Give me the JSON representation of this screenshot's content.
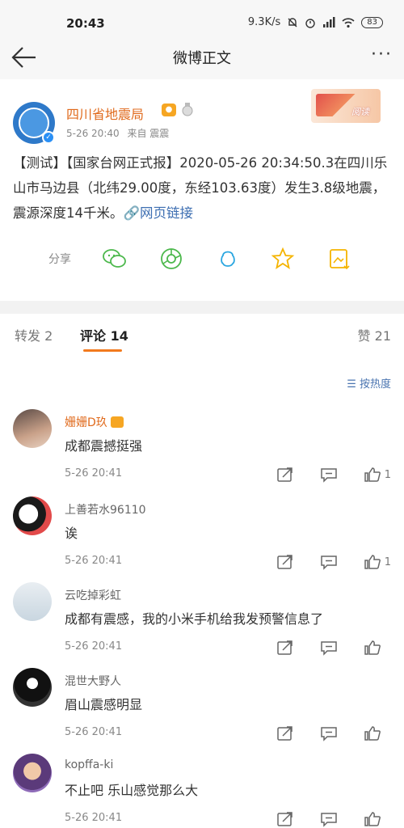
{
  "status": {
    "time": "20:43",
    "net_speed": "9.3K/s",
    "battery": "83"
  },
  "nav": {
    "title": "微博正文",
    "more": "···"
  },
  "post": {
    "author": "四川省地震局",
    "time": "5-26 20:40",
    "source": "来自 震震",
    "anniversary_stamp": "阅读",
    "body": "【测试】【国家台网正式报】2020-05-26 20:34:50.3在四川乐山市马边县（北纬29.00度，东经103.63度）发生3.8级地震，震源深度14千米。",
    "link_text": "网页链接",
    "share_label": "分享",
    "share_icons": [
      "wechat-icon",
      "moments-icon",
      "qq-icon",
      "qzone-star-icon",
      "save-image-icon"
    ]
  },
  "tabs": {
    "repost": "转发 2",
    "comments": "评论 14",
    "likes": "赞 21"
  },
  "sort_label": "按热度",
  "comments": [
    {
      "user": "姗姗D玖",
      "text": "成都震撼挺强",
      "time": "5-26 20:41",
      "likes": "1"
    },
    {
      "user": "上善若水96110",
      "text": "诶",
      "time": "5-26 20:41",
      "likes": "1"
    },
    {
      "user": "云吃掉彩虹",
      "text": "成都有震感，我的小米手机给我发预警信息了",
      "time": "5-26 20:41",
      "likes": ""
    },
    {
      "user": "混世大野人",
      "text": "眉山震感明显",
      "time": "5-26 20:41",
      "likes": ""
    },
    {
      "user": "kopffa-ki",
      "text": "不止吧 乐山感觉那么大",
      "time": "5-26 20:41",
      "likes": ""
    }
  ],
  "colors": {
    "accent": "#f27a1e",
    "author": "#e06a1c",
    "link": "#3e6fb2",
    "share_green": "#4cb84c",
    "share_blue": "#2aa6e0",
    "share_yellow": "#f5b400"
  }
}
